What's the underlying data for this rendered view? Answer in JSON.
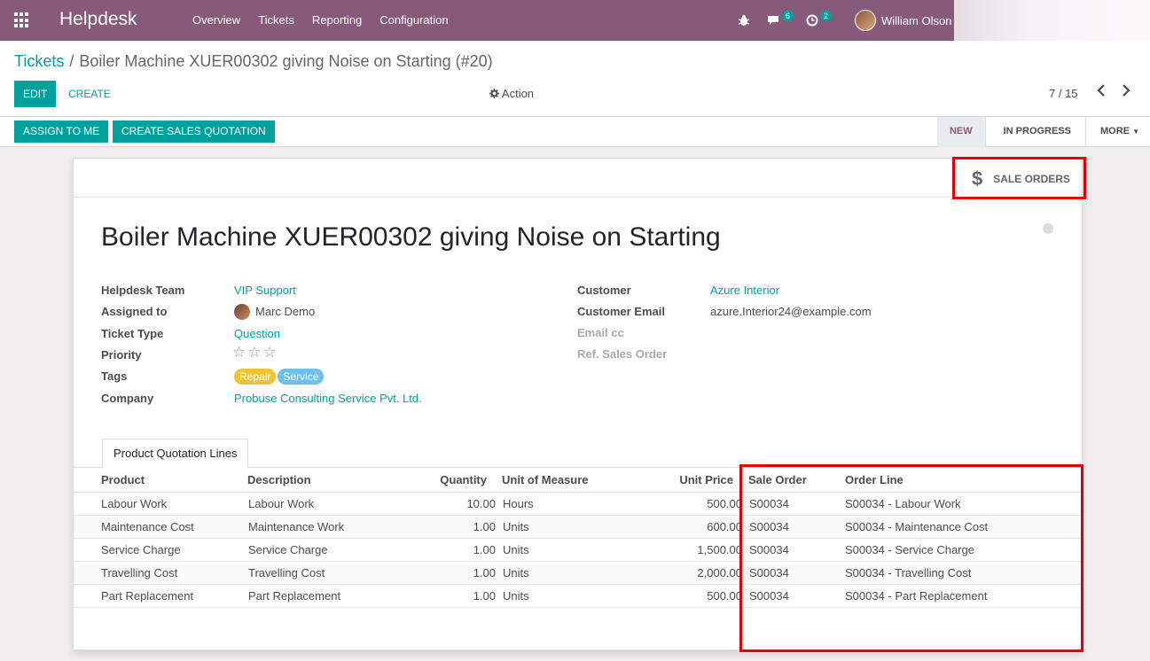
{
  "navbar": {
    "brand": "Helpdesk",
    "menu": [
      "Overview",
      "Tickets",
      "Reporting",
      "Configuration"
    ],
    "chat_count": "6",
    "activity_count": "2",
    "user_name": "William Olson"
  },
  "breadcrumb": {
    "parent": "Tickets",
    "separator": "/",
    "current": "Boiler Machine XUER00302 giving Noise on Starting (#20)"
  },
  "toolbar": {
    "edit_label": "EDIT",
    "create_label": "CREATE",
    "action_label": "Action",
    "pager": "7 / 15"
  },
  "statusbar": {
    "assign_label": "ASSIGN TO ME",
    "quotation_label": "CREATE SALES QUOTATION",
    "stages": [
      "NEW",
      "IN PROGRESS",
      "MORE"
    ],
    "active_stage": "NEW"
  },
  "smart_button": {
    "label": "SALE ORDERS",
    "icon": "dollar-icon"
  },
  "ticket": {
    "title": "Boiler Machine XUER00302 giving Noise on Starting",
    "left_fields": {
      "team_label": "Helpdesk Team",
      "team_value": "VIP Support",
      "assigned_label": "Assigned to",
      "assigned_value": "Marc Demo",
      "type_label": "Ticket Type",
      "type_value": "Question",
      "priority_label": "Priority",
      "priority_stars": 0,
      "priority_max": 3,
      "tags_label": "Tags",
      "tags": [
        {
          "name": "Repair",
          "color": "#f0c330"
        },
        {
          "name": "Service",
          "color": "#6cc1ed"
        }
      ],
      "company_label": "Company",
      "company_value": "Probuse Consulting Service Pvt. Ltd."
    },
    "right_fields": {
      "customer_label": "Customer",
      "customer_value": "Azure Interior",
      "email_label": "Customer Email",
      "email_value": "azure.Interior24@example.com",
      "cc_label": "Email cc",
      "ref_label": "Ref. Sales Order"
    }
  },
  "tab": {
    "label": "Product Quotation Lines"
  },
  "table": {
    "headers": [
      "Product",
      "Description",
      "Quantity",
      "Unit of Measure",
      "Unit Price",
      "Sale Order",
      "Order Line"
    ],
    "rows": [
      [
        "Labour Work",
        "Labour Work",
        "10.00",
        "Hours",
        "500.00",
        "S00034",
        "S00034 - Labour Work"
      ],
      [
        "Maintenance Cost",
        "Maintenance Work",
        "1.00",
        "Units",
        "600.00",
        "S00034",
        "S00034 - Maintenance Cost"
      ],
      [
        "Service Charge",
        "Service Charge",
        "1.00",
        "Units",
        "1,500.00",
        "S00034",
        "S00034 - Service Charge"
      ],
      [
        "Travelling Cost",
        "Travelling Cost",
        "1.00",
        "Units",
        "2,000.00",
        "S00034",
        "S00034 - Travelling Cost"
      ],
      [
        "Part Replacement",
        "Part Replacement",
        "1.00",
        "Units",
        "500.00",
        "S00034",
        "S00034 - Part Replacement"
      ]
    ]
  },
  "colors": {
    "brand": "#875a7b",
    "accent": "#00a09d",
    "highlight": "#e20000"
  }
}
